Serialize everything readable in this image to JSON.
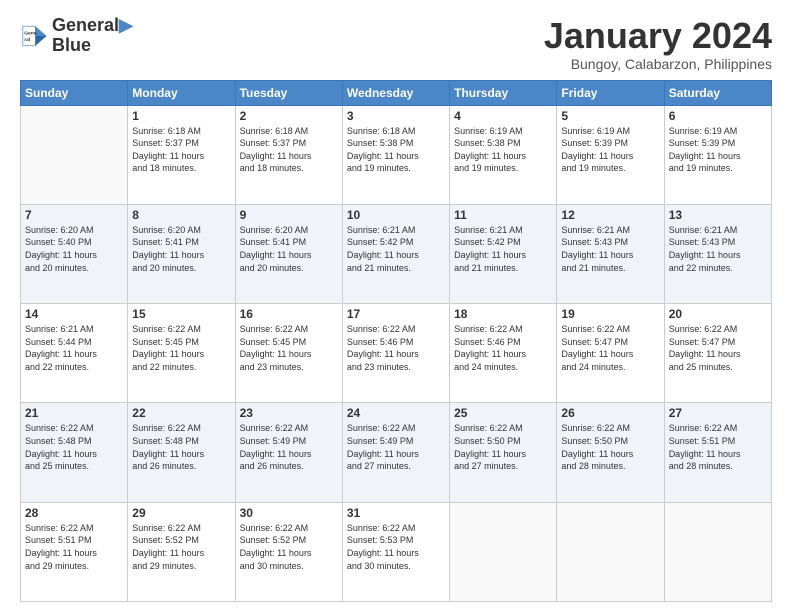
{
  "logo": {
    "line1": "General",
    "line2": "Blue"
  },
  "title": "January 2024",
  "subtitle": "Bungoy, Calabarzon, Philippines",
  "days_of_week": [
    "Sunday",
    "Monday",
    "Tuesday",
    "Wednesday",
    "Thursday",
    "Friday",
    "Saturday"
  ],
  "weeks": [
    [
      {
        "num": "",
        "info": ""
      },
      {
        "num": "1",
        "info": "Sunrise: 6:18 AM\nSunset: 5:37 PM\nDaylight: 11 hours\nand 18 minutes."
      },
      {
        "num": "2",
        "info": "Sunrise: 6:18 AM\nSunset: 5:37 PM\nDaylight: 11 hours\nand 18 minutes."
      },
      {
        "num": "3",
        "info": "Sunrise: 6:18 AM\nSunset: 5:38 PM\nDaylight: 11 hours\nand 19 minutes."
      },
      {
        "num": "4",
        "info": "Sunrise: 6:19 AM\nSunset: 5:38 PM\nDaylight: 11 hours\nand 19 minutes."
      },
      {
        "num": "5",
        "info": "Sunrise: 6:19 AM\nSunset: 5:39 PM\nDaylight: 11 hours\nand 19 minutes."
      },
      {
        "num": "6",
        "info": "Sunrise: 6:19 AM\nSunset: 5:39 PM\nDaylight: 11 hours\nand 19 minutes."
      }
    ],
    [
      {
        "num": "7",
        "info": "Sunrise: 6:20 AM\nSunset: 5:40 PM\nDaylight: 11 hours\nand 20 minutes."
      },
      {
        "num": "8",
        "info": "Sunrise: 6:20 AM\nSunset: 5:41 PM\nDaylight: 11 hours\nand 20 minutes."
      },
      {
        "num": "9",
        "info": "Sunrise: 6:20 AM\nSunset: 5:41 PM\nDaylight: 11 hours\nand 20 minutes."
      },
      {
        "num": "10",
        "info": "Sunrise: 6:21 AM\nSunset: 5:42 PM\nDaylight: 11 hours\nand 21 minutes."
      },
      {
        "num": "11",
        "info": "Sunrise: 6:21 AM\nSunset: 5:42 PM\nDaylight: 11 hours\nand 21 minutes."
      },
      {
        "num": "12",
        "info": "Sunrise: 6:21 AM\nSunset: 5:43 PM\nDaylight: 11 hours\nand 21 minutes."
      },
      {
        "num": "13",
        "info": "Sunrise: 6:21 AM\nSunset: 5:43 PM\nDaylight: 11 hours\nand 22 minutes."
      }
    ],
    [
      {
        "num": "14",
        "info": "Sunrise: 6:21 AM\nSunset: 5:44 PM\nDaylight: 11 hours\nand 22 minutes."
      },
      {
        "num": "15",
        "info": "Sunrise: 6:22 AM\nSunset: 5:45 PM\nDaylight: 11 hours\nand 22 minutes."
      },
      {
        "num": "16",
        "info": "Sunrise: 6:22 AM\nSunset: 5:45 PM\nDaylight: 11 hours\nand 23 minutes."
      },
      {
        "num": "17",
        "info": "Sunrise: 6:22 AM\nSunset: 5:46 PM\nDaylight: 11 hours\nand 23 minutes."
      },
      {
        "num": "18",
        "info": "Sunrise: 6:22 AM\nSunset: 5:46 PM\nDaylight: 11 hours\nand 24 minutes."
      },
      {
        "num": "19",
        "info": "Sunrise: 6:22 AM\nSunset: 5:47 PM\nDaylight: 11 hours\nand 24 minutes."
      },
      {
        "num": "20",
        "info": "Sunrise: 6:22 AM\nSunset: 5:47 PM\nDaylight: 11 hours\nand 25 minutes."
      }
    ],
    [
      {
        "num": "21",
        "info": "Sunrise: 6:22 AM\nSunset: 5:48 PM\nDaylight: 11 hours\nand 25 minutes."
      },
      {
        "num": "22",
        "info": "Sunrise: 6:22 AM\nSunset: 5:48 PM\nDaylight: 11 hours\nand 26 minutes."
      },
      {
        "num": "23",
        "info": "Sunrise: 6:22 AM\nSunset: 5:49 PM\nDaylight: 11 hours\nand 26 minutes."
      },
      {
        "num": "24",
        "info": "Sunrise: 6:22 AM\nSunset: 5:49 PM\nDaylight: 11 hours\nand 27 minutes."
      },
      {
        "num": "25",
        "info": "Sunrise: 6:22 AM\nSunset: 5:50 PM\nDaylight: 11 hours\nand 27 minutes."
      },
      {
        "num": "26",
        "info": "Sunrise: 6:22 AM\nSunset: 5:50 PM\nDaylight: 11 hours\nand 28 minutes."
      },
      {
        "num": "27",
        "info": "Sunrise: 6:22 AM\nSunset: 5:51 PM\nDaylight: 11 hours\nand 28 minutes."
      }
    ],
    [
      {
        "num": "28",
        "info": "Sunrise: 6:22 AM\nSunset: 5:51 PM\nDaylight: 11 hours\nand 29 minutes."
      },
      {
        "num": "29",
        "info": "Sunrise: 6:22 AM\nSunset: 5:52 PM\nDaylight: 11 hours\nand 29 minutes."
      },
      {
        "num": "30",
        "info": "Sunrise: 6:22 AM\nSunset: 5:52 PM\nDaylight: 11 hours\nand 30 minutes."
      },
      {
        "num": "31",
        "info": "Sunrise: 6:22 AM\nSunset: 5:53 PM\nDaylight: 11 hours\nand 30 minutes."
      },
      {
        "num": "",
        "info": ""
      },
      {
        "num": "",
        "info": ""
      },
      {
        "num": "",
        "info": ""
      }
    ]
  ]
}
